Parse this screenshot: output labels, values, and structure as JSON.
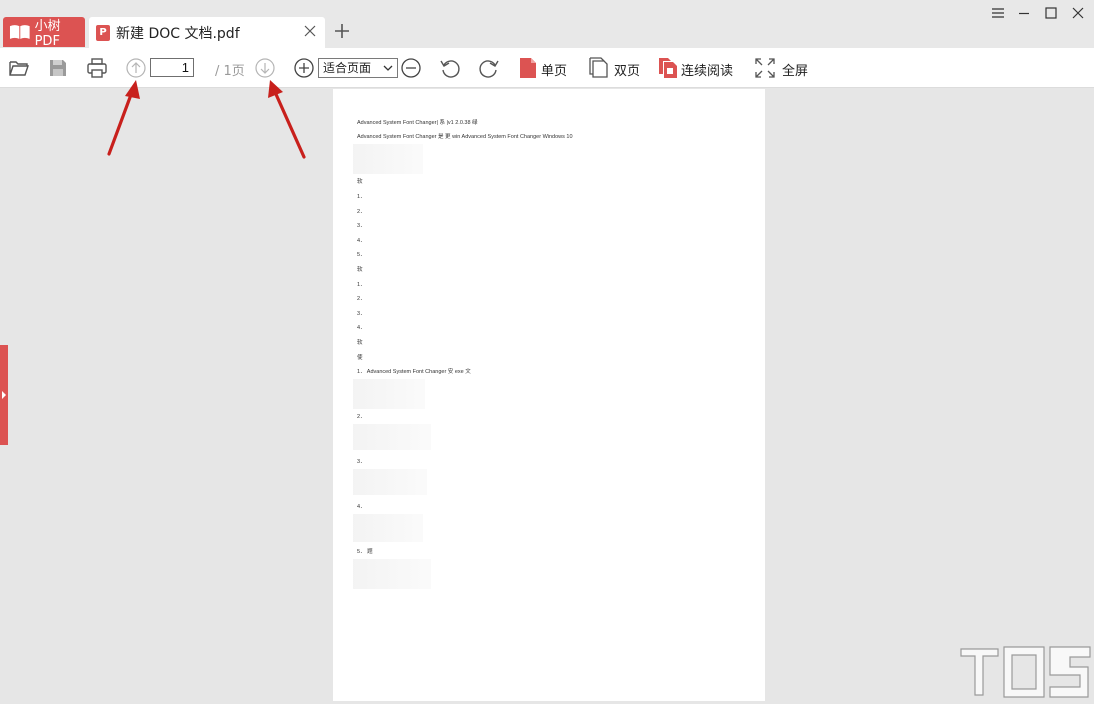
{
  "app": {
    "name": "小树PDF"
  },
  "tabs": [
    {
      "label": "新建 DOC 文档.pdf",
      "badge": "P"
    }
  ],
  "toolbar": {
    "page_current": "1",
    "page_total": "/ 1页",
    "zoom": "适合页面",
    "single_page": "单页",
    "double_page": "双页",
    "continuous": "连续阅读",
    "fullscreen": "全屏"
  },
  "document": {
    "lines": [
      "Advanced System Font Changer| 系 |v1 2.0.38 绿",
      "Advanced System Font Changer 是 更 win Advanced System Font Changer Windows 10",
      "软",
      "1．",
      "2．",
      "3．",
      "4．",
      "5．",
      "软",
      "1．",
      "2．",
      "3．",
      "4．",
      "软",
      "使",
      "1． Advanced System Font Changer 安 exe 文",
      "2．",
      "3．",
      "4．",
      "5． 题"
    ]
  },
  "colors": {
    "brand": "#dc5352",
    "arrow": "#c8201c"
  }
}
